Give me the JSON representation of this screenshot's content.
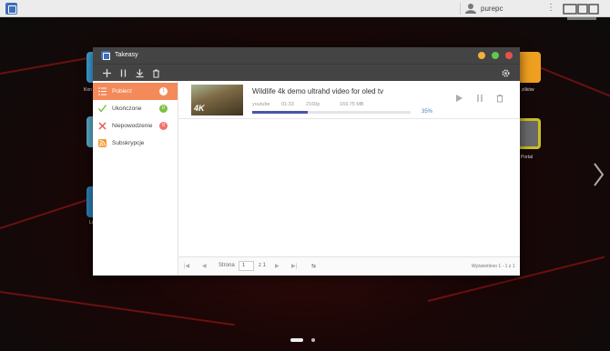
{
  "topbar": {
    "user": "purepc",
    "icons": {
      "home": "apps-icon",
      "user": "user-icon",
      "more": "more-icon",
      "logo": "brand-logo"
    }
  },
  "desktop": {
    "left_labels": [
      "Kon",
      "Lo"
    ],
    "right_labels": [
      "zlików",
      "Portal"
    ]
  },
  "window": {
    "title": "Takeasy",
    "controls": {
      "minimize_color": "#f0b03c",
      "maximize_color": "#62c554",
      "close_color": "#e5534b"
    },
    "toolbar": [
      "add-icon",
      "pause-icon",
      "download-icon",
      "delete-icon",
      "settings-icon"
    ]
  },
  "sidebar": {
    "items": [
      {
        "label": "Pobierz",
        "badge": "1",
        "badge_color": "#ffffff",
        "active": true,
        "icon": "list-icon"
      },
      {
        "label": "Ukończone",
        "badge": "0",
        "badge_color": "#7bc043",
        "active": false,
        "icon": "check-icon"
      },
      {
        "label": "Niepowodzenie",
        "badge": "0",
        "badge_color": "#f0726b",
        "active": false,
        "icon": "cross-icon"
      },
      {
        "label": "Subskrypcje",
        "badge": "",
        "badge_color": "",
        "active": false,
        "icon": "rss-icon"
      }
    ]
  },
  "task": {
    "title": "Wildlife 4k demo ultrahd video for oled tv",
    "thumb_badge": "4K",
    "source": "youtube",
    "duration": "01:33",
    "quality": "2160p",
    "size": "169.75 MB",
    "progress": 35,
    "progress_text": "35%"
  },
  "pager": {
    "page_label": "Strona",
    "page": "1",
    "of": "z 1",
    "summary": "Wyświetlono 1 - 1 z 1"
  },
  "accent": "#f48a5a"
}
